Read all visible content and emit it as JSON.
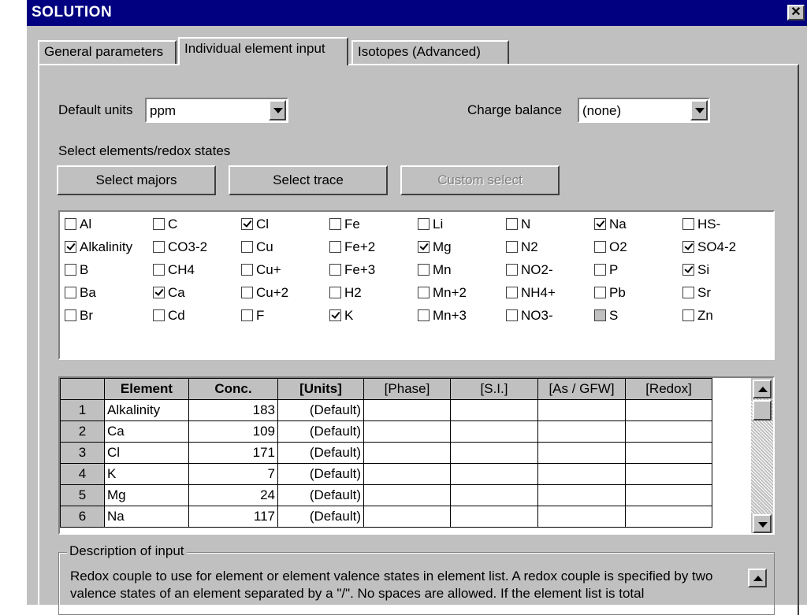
{
  "window": {
    "title": "SOLUTION",
    "close_glyph": "✕"
  },
  "tabs": [
    {
      "label": "General parameters",
      "active": false
    },
    {
      "label": "Individual element input",
      "active": true
    },
    {
      "label": "Isotopes (Advanced)",
      "active": false
    }
  ],
  "default_units": {
    "label": "Default units",
    "value": "ppm"
  },
  "charge_balance": {
    "label": "Charge balance",
    "value": "(none)"
  },
  "select_section": {
    "label": "Select elements/redox states"
  },
  "buttons": {
    "select_majors": "Select majors",
    "select_trace": "Select trace",
    "custom_select": "Custom select"
  },
  "elements": [
    [
      {
        "label": "Al",
        "checked": false
      },
      {
        "label": "Alkalinity",
        "checked": true
      },
      {
        "label": "B",
        "checked": false
      },
      {
        "label": "Ba",
        "checked": false
      },
      {
        "label": "Br",
        "checked": false
      }
    ],
    [
      {
        "label": "C",
        "checked": false
      },
      {
        "label": "CO3-2",
        "checked": false
      },
      {
        "label": "CH4",
        "checked": false
      },
      {
        "label": "Ca",
        "checked": true
      },
      {
        "label": "Cd",
        "checked": false
      }
    ],
    [
      {
        "label": "Cl",
        "checked": true
      },
      {
        "label": "Cu",
        "checked": false
      },
      {
        "label": "Cu+",
        "checked": false
      },
      {
        "label": "Cu+2",
        "checked": false
      },
      {
        "label": "F",
        "checked": false
      }
    ],
    [
      {
        "label": "Fe",
        "checked": false
      },
      {
        "label": "Fe+2",
        "checked": false
      },
      {
        "label": "Fe+3",
        "checked": false
      },
      {
        "label": "H2",
        "checked": false
      },
      {
        "label": "K",
        "checked": true
      }
    ],
    [
      {
        "label": "Li",
        "checked": false
      },
      {
        "label": "Mg",
        "checked": true
      },
      {
        "label": "Mn",
        "checked": false
      },
      {
        "label": "Mn+2",
        "checked": false
      },
      {
        "label": "Mn+3",
        "checked": false
      }
    ],
    [
      {
        "label": "N",
        "checked": false
      },
      {
        "label": "N2",
        "checked": false
      },
      {
        "label": "NO2-",
        "checked": false
      },
      {
        "label": "NH4+",
        "checked": false
      },
      {
        "label": "NO3-",
        "checked": false
      }
    ],
    [
      {
        "label": "Na",
        "checked": true
      },
      {
        "label": "O2",
        "checked": false
      },
      {
        "label": "P",
        "checked": false
      },
      {
        "label": "Pb",
        "checked": false
      },
      {
        "label": "S",
        "checked": false,
        "grayed": true
      }
    ],
    [
      {
        "label": "HS-",
        "checked": false
      },
      {
        "label": "SO4-2",
        "checked": true
      },
      {
        "label": "Si",
        "checked": true
      },
      {
        "label": "Sr",
        "checked": false
      },
      {
        "label": "Zn",
        "checked": false
      }
    ]
  ],
  "grid": {
    "headers": [
      "Element",
      "Conc.",
      "[Units]",
      "[Phase]",
      "[S.I.]",
      "[As / GFW]",
      "[Redox]"
    ],
    "rows": [
      {
        "num": "1",
        "element": "Alkalinity",
        "conc": "183",
        "units": "(Default)"
      },
      {
        "num": "2",
        "element": "Ca",
        "conc": "109",
        "units": "(Default)"
      },
      {
        "num": "3",
        "element": "Cl",
        "conc": "171",
        "units": "(Default)"
      },
      {
        "num": "4",
        "element": "K",
        "conc": "7",
        "units": "(Default)"
      },
      {
        "num": "5",
        "element": "Mg",
        "conc": "24",
        "units": "(Default)"
      },
      {
        "num": "6",
        "element": "Na",
        "conc": "117",
        "units": "(Default)"
      }
    ]
  },
  "description": {
    "legend": "Description of input",
    "text": "Redox couple to use for element or element valence states in element list. A redox couple is specified by two valence states of an element separated by a \"/\". No spaces are allowed. If the element list is total"
  }
}
